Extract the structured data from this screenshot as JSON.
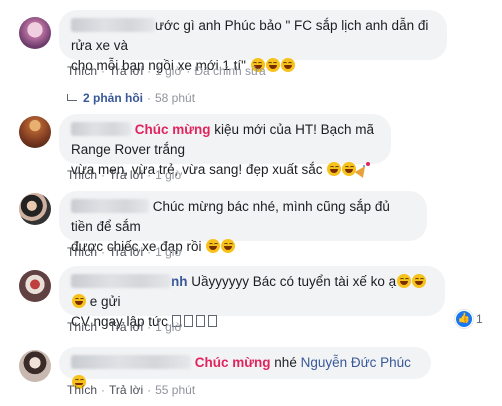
{
  "comments": [
    {
      "text_line1": "ước gì anh Phúc bảo \" FC sắp lịch anh dẫn đi rửa xe và",
      "text_line2": "cho mỗi bạn ngồi xe mới 1 tí\"",
      "actions": {
        "like": "Thích",
        "reply": "Trả lời",
        "time": "1 giờ",
        "edited": "Đã chỉnh sửa"
      },
      "replies": {
        "label": "2 phản hồi",
        "time": "58 phút"
      }
    },
    {
      "highlight": "Chúc mừng",
      "text_line1": " kiệu mới của HT! Bạch mã Range Rover trắng",
      "text_line2": "vừa men, vừa trẻ, vừa sang! đẹp xuất sắc",
      "actions": {
        "like": "Thích",
        "reply": "Trả lời",
        "time": "1 giờ"
      }
    },
    {
      "text_line1": "Chúc mừng bác nhé, mình cũng sắp đủ tiền để sắm",
      "text_line2": "được chiếc xe đạp rồi",
      "actions": {
        "like": "Thích",
        "reply": "Trả lời",
        "time": "1 giờ"
      }
    },
    {
      "name_tail": "nh",
      "text_line1": " Uầyyyyyy Bác có tuyển tài xế ko ạ",
      "text_line1_tail": " e gửi",
      "text_line2": "CV ngay lập tức",
      "actions": {
        "like": "Thích",
        "reply": "Trả lời",
        "time": "1 giờ"
      },
      "reaction_count": "1"
    },
    {
      "highlight": "Chúc mừng",
      "text_mid": " nhé ",
      "mention": "Nguyễn Đức Phúc",
      "actions": {
        "like": "Thích",
        "reply": "Trả lời",
        "time": "55 phút"
      }
    }
  ],
  "colors": {
    "highlight": "#e0245e",
    "mention": "#385898",
    "bubble": "#f2f3f5",
    "like": "#1877f2"
  }
}
